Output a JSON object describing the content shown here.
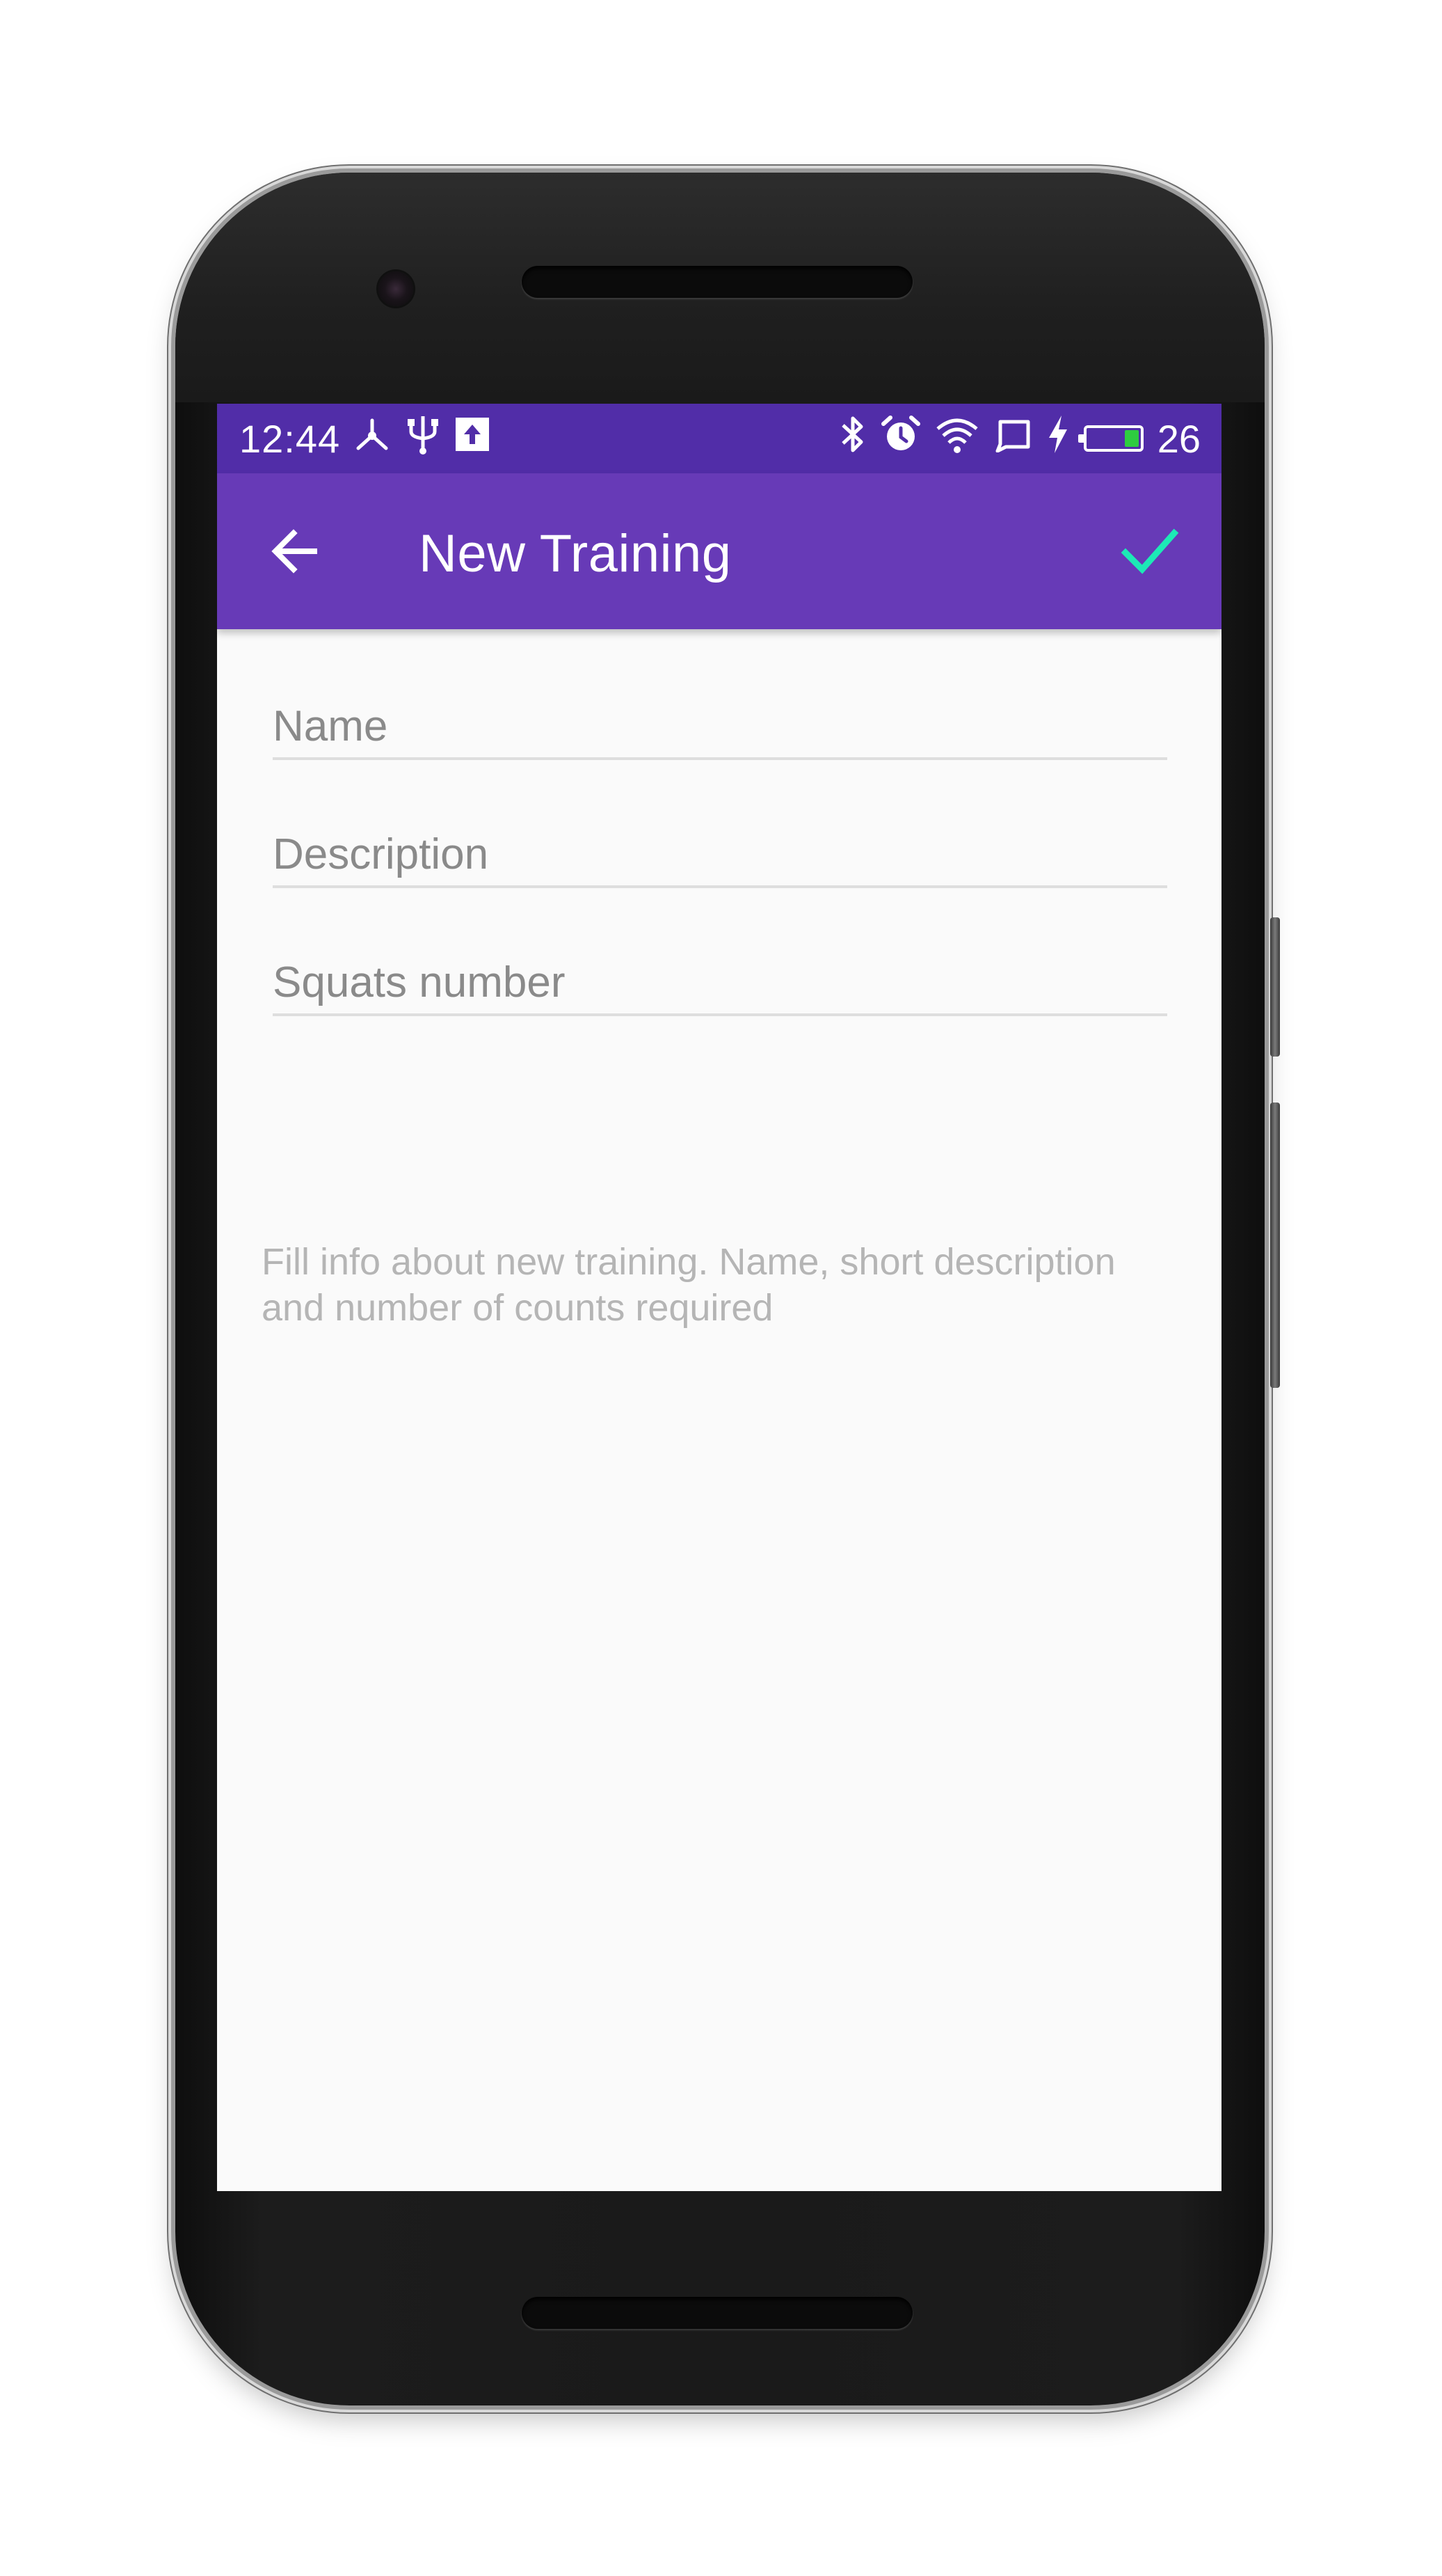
{
  "status_bar": {
    "time": "12:44",
    "left_icons": [
      "network-icon",
      "usb-icon",
      "upload-icon"
    ],
    "right_icons": [
      "bluetooth-icon",
      "alarm-icon",
      "wifi-icon",
      "cast-icon",
      "charging-icon"
    ],
    "battery_level": "26",
    "battery_color": "#2ecc40"
  },
  "app_bar": {
    "back_icon": "arrow-back-icon",
    "title": "New Training",
    "confirm_icon": "check-icon",
    "confirm_color": "#1de9b6"
  },
  "form": {
    "fields": [
      {
        "placeholder": "Name",
        "value": ""
      },
      {
        "placeholder": "Description",
        "value": ""
      },
      {
        "placeholder": "Squats number",
        "value": ""
      }
    ],
    "hint": "Fill info about new training. Name, short description and number of counts required"
  },
  "colors": {
    "status_bar": "#512da8",
    "app_bar": "#673ab7",
    "background": "#fafafa"
  }
}
